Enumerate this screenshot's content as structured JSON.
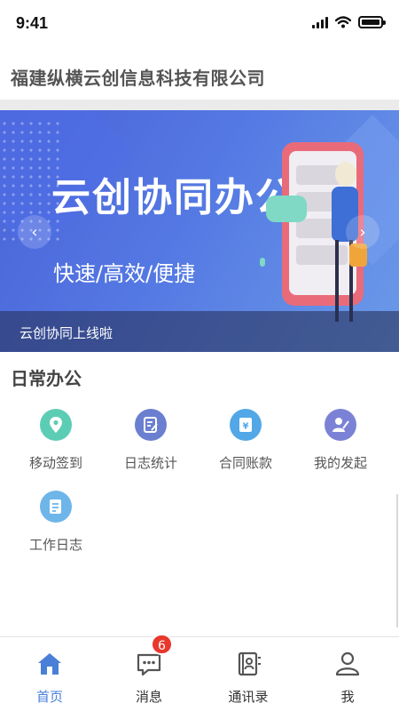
{
  "status_bar": {
    "time": "9:41"
  },
  "header": {
    "company_name": "福建纵横云创信息科技有限公司"
  },
  "banner": {
    "headline": "云创协同办公",
    "subtitle": "快速/高效/便捷",
    "caption": "云创协同上线啦",
    "prev_icon": "chevron-left-icon",
    "next_icon": "chevron-right-icon"
  },
  "daily_office": {
    "title": "日常办公",
    "items": [
      {
        "label": "移动签到",
        "icon": "location-pin-icon",
        "color": "#5ccdb5"
      },
      {
        "label": "日志统计",
        "icon": "log-stats-icon",
        "color": "#6b7fd1"
      },
      {
        "label": "合同账款",
        "icon": "contract-icon",
        "color": "#52a7e6"
      },
      {
        "label": "我的发起",
        "icon": "my-initiated-icon",
        "color": "#7b82d6"
      },
      {
        "label": "工作日志",
        "icon": "work-log-icon",
        "color": "#6eb5e9"
      }
    ]
  },
  "tabbar": {
    "tabs": [
      {
        "label": "首页",
        "icon": "home-icon",
        "active": true
      },
      {
        "label": "消息",
        "icon": "message-icon",
        "badge": "6"
      },
      {
        "label": "通讯录",
        "icon": "contacts-icon"
      },
      {
        "label": "我",
        "icon": "profile-icon"
      }
    ],
    "active_color": "#4a7fd8"
  }
}
